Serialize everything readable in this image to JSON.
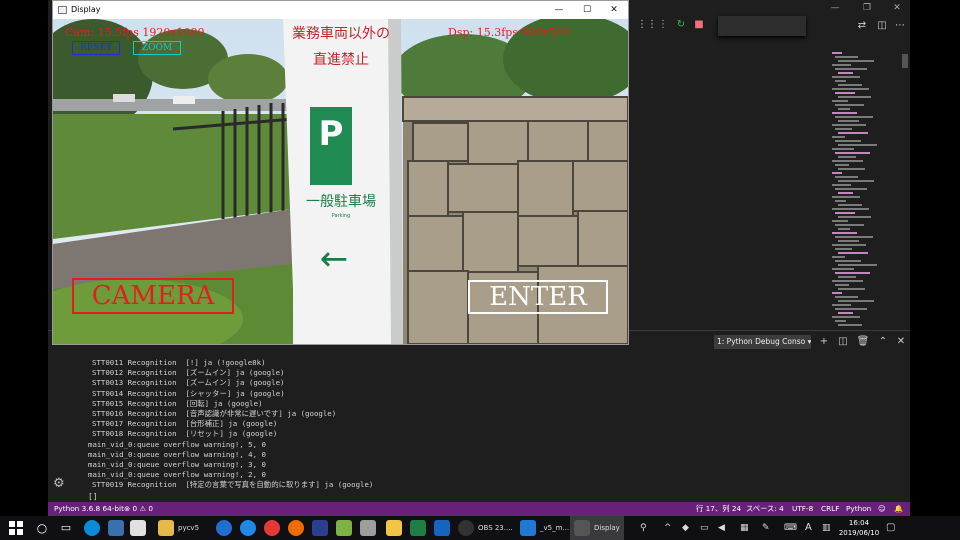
{
  "display_window": {
    "title": "Display",
    "overlay": {
      "cam_fps": "Cam: 15.5fps 1920x1080",
      "dsp_fps": "Dsp: 15.3fps 960x540",
      "reset_button": "RESET",
      "zoom_button": "ZOOM",
      "camera_button": "CAMERA",
      "enter_button": "ENTER"
    },
    "sign": {
      "line1": "業務車両以外の",
      "line2": "直進禁止",
      "p_letter": "P",
      "line3": "一般駐車場",
      "line4": "Parking",
      "arrow": "←"
    }
  },
  "terminal": {
    "dropdown": "1: Python Debug Conso",
    "lines": [
      "STT0011 Recognition  [!] ja (!google8k)",
      "STT0012 Recognition  [ズームイン] ja (google)",
      "STT0013 Recognition  [ズームイン] ja (google)",
      "STT0014 Recognition  [シャッター] ja (google)",
      "STT0015 Recognition  [回転] ja (google)",
      "STT0016 Recognition  [音声認識が非常に遅いです] ja (google)",
      "STT0017 Recognition  [台形補正] ja (google)",
      "STT0018 Recognition  [リセット] ja (google)",
      "main_vid_0:queue overflow warning!, 5, 0",
      "main_vid_0:queue overflow warning!, 4, 0",
      "main_vid_0:queue overflow warning!, 3, 0",
      "main_vid_0:queue overflow warning!, 2, 0",
      "STT0019 Recognition  [特定の言葉で写真を自動的に取ります] ja (google)"
    ],
    "cursor": "[]"
  },
  "status_bar": {
    "python": "Python 3.6.8 64-bit",
    "errors": "0",
    "warnings": "0",
    "position": "行 17、列 24",
    "spaces": "スペース: 4",
    "encoding": "UTF-8",
    "eol": "CRLF",
    "language": "Python"
  },
  "taskbar": {
    "pycv5": "pycv5",
    "obs": "OBS 23....",
    "vscode": "_v5_m...",
    "display": "Display",
    "ime": "A",
    "time": "16:04",
    "date": "2019/06/10"
  },
  "colors": {
    "statusbar": "#68217a",
    "camera_button": "#e0201c",
    "reset_button": "#1a2fd6",
    "zoom_button": "#19c7c7"
  }
}
